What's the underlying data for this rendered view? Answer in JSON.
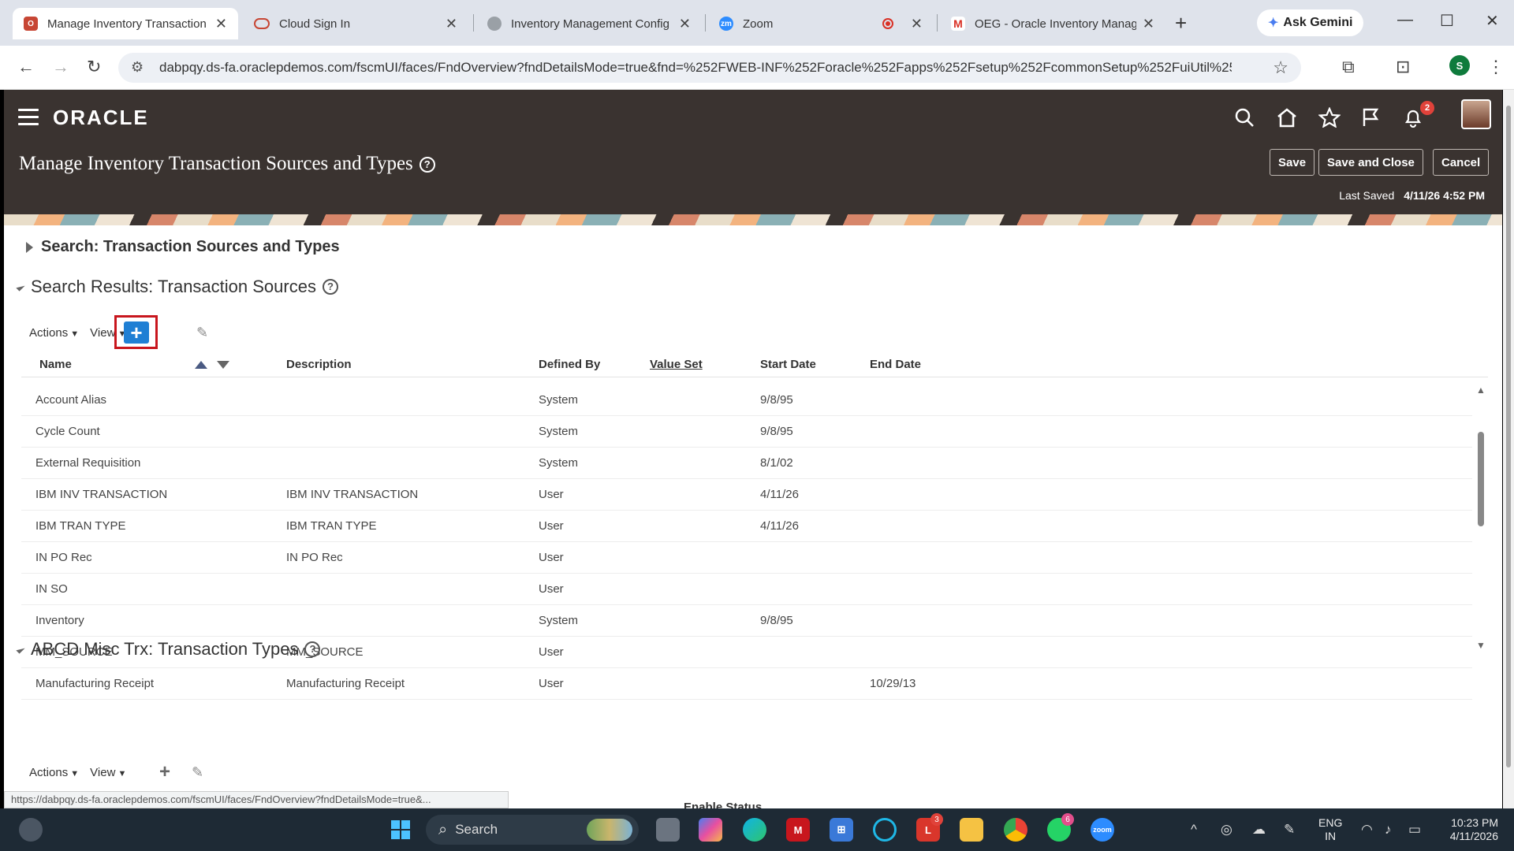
{
  "browser": {
    "tabs": [
      {
        "title": "Manage Inventory Transaction",
        "active": true
      },
      {
        "title": "Cloud Sign In"
      },
      {
        "title": "Inventory Management Config"
      },
      {
        "title": "Zoom"
      },
      {
        "title": "OEG - Oracle Inventory Manag"
      }
    ],
    "ask_gemini": "Ask Gemini",
    "url": "dabpqy.ds-fa.oraclepdemos.com/fscmUI/faces/FndOverview?fndDetailsMode=true&fnd=%252FWEB-INF%252Foracle%252Fapps%252Fsetup%252FcommonSetup%252FuiUtil%252F...",
    "profile_initial": "S",
    "status_url": "https://dabpqy.ds-fa.oraclepdemos.com/fscmUI/faces/FndOverview?fndDetailsMode=true&..."
  },
  "app": {
    "logo": "ORACLE",
    "notification_count": "2",
    "page_title": "Manage Inventory Transaction Sources and Types",
    "buttons": {
      "save": "Save",
      "save_close": "Save and Close",
      "cancel": "Cancel"
    },
    "last_saved_label": "Last Saved",
    "last_saved_value": "4/11/26 4:52 PM",
    "search_section": "Search: Transaction Sources and Types",
    "results_section": "Search Results: Transaction Sources",
    "types_section": "ABCD Misc Trx: Transaction Types",
    "toolbar": {
      "actions": "Actions",
      "view": "View"
    },
    "columns": {
      "name": "Name",
      "description": "Description",
      "defined_by": "Defined By",
      "value_set": "Value Set",
      "start_date": "Start Date",
      "end_date": "End Date"
    },
    "rows": [
      {
        "name": "Account Alias",
        "description": "",
        "defined_by": "System",
        "value_set": "",
        "start_date": "9/8/95",
        "end_date": ""
      },
      {
        "name": "Cycle Count",
        "description": "",
        "defined_by": "System",
        "value_set": "",
        "start_date": "9/8/95",
        "end_date": ""
      },
      {
        "name": "External Requisition",
        "description": "",
        "defined_by": "System",
        "value_set": "",
        "start_date": "8/1/02",
        "end_date": ""
      },
      {
        "name": "IBM INV TRANSACTION",
        "description": "IBM INV TRANSACTION",
        "defined_by": "User",
        "value_set": "",
        "start_date": "4/11/26",
        "end_date": ""
      },
      {
        "name": "IBM TRAN TYPE",
        "description": "IBM TRAN TYPE",
        "defined_by": "User",
        "value_set": "",
        "start_date": "4/11/26",
        "end_date": ""
      },
      {
        "name": "IN PO Rec",
        "description": "IN PO Rec",
        "defined_by": "User",
        "value_set": "",
        "start_date": "",
        "end_date": ""
      },
      {
        "name": "IN SO",
        "description": "",
        "defined_by": "User",
        "value_set": "",
        "start_date": "",
        "end_date": ""
      },
      {
        "name": "Inventory",
        "description": "",
        "defined_by": "System",
        "value_set": "",
        "start_date": "9/8/95",
        "end_date": ""
      },
      {
        "name": "MM_SOURCE",
        "description": "MM_SOURCE",
        "defined_by": "User",
        "value_set": "",
        "start_date": "",
        "end_date": ""
      },
      {
        "name": "Manufacturing Receipt",
        "description": "Manufacturing Receipt",
        "defined_by": "User",
        "value_set": "",
        "start_date": "",
        "end_date": "10/29/13"
      }
    ],
    "enable_status": "Enable Status"
  },
  "taskbar": {
    "search": "Search",
    "badges": {
      "l_app": "3",
      "whatsapp": "6"
    },
    "lang_1": "ENG",
    "lang_2": "IN",
    "time": "10:23 PM",
    "date": "4/11/2026"
  },
  "colors": {
    "oracle_header": "#3a3330",
    "add_button": "#1f7fd4",
    "highlight": "#c8161d"
  }
}
